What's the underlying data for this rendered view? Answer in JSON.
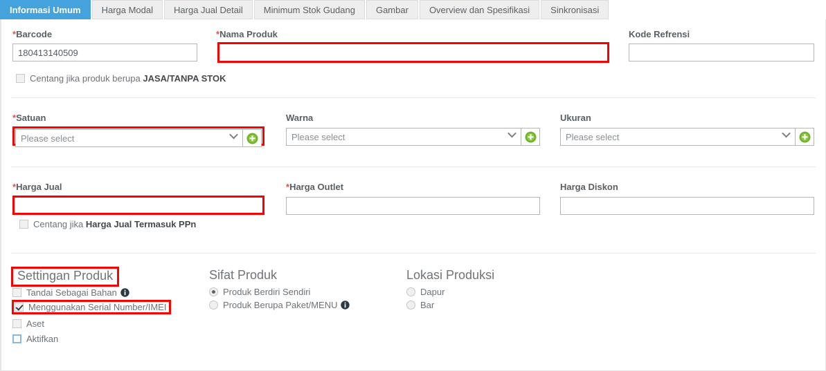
{
  "tabs": [
    {
      "label": "Informasi Umum",
      "active": true
    },
    {
      "label": "Harga Modal",
      "active": false
    },
    {
      "label": "Harga Jual Detail",
      "active": false
    },
    {
      "label": "Minimum Stok Gudang",
      "active": false
    },
    {
      "label": "Gambar",
      "active": false
    },
    {
      "label": "Overview dan Spesifikasi",
      "active": false
    },
    {
      "label": "Sinkronisasi",
      "active": false
    }
  ],
  "colors": {
    "tab_active_bg": "#44a3dd",
    "error_border": "#fb0000",
    "plus_green": "#6eb42b",
    "required_star": "#d9534f",
    "label_text": "#595f63"
  },
  "section_identity": {
    "barcode": {
      "star": "*",
      "label": "Barcode",
      "value": "180413140509",
      "placeholder": ""
    },
    "nama_produk": {
      "star": "*",
      "label": "Nama Produk",
      "value": "",
      "placeholder": ""
    },
    "kode_refrensi": {
      "star": "",
      "label": "Kode Refrensi",
      "value": "",
      "placeholder": ""
    },
    "jasa_checkbox": {
      "prefix": "Centang jika produk berupa ",
      "strong": "JASA/TANPA STOK",
      "checked": false
    }
  },
  "section_variant": {
    "satuan": {
      "star": "*",
      "label": "Satuan",
      "selected": "Please select",
      "add_button": "plus",
      "error": true
    },
    "warna": {
      "star": "",
      "label": "Warna",
      "selected": "Please select",
      "add_button": "plus",
      "error": false
    },
    "ukuran": {
      "star": "",
      "label": "Ukuran",
      "selected": "Please select",
      "add_button": "plus",
      "error": false
    }
  },
  "section_price": {
    "harga_jual": {
      "star": "*",
      "label": "Harga Jual",
      "value": "",
      "error": true
    },
    "harga_outlet": {
      "star": "*",
      "label": "Harga Outlet",
      "value": "",
      "error": false
    },
    "harga_diskon": {
      "star": "",
      "label": "Harga Diskon",
      "value": "",
      "error": false
    },
    "ppn_checkbox": {
      "prefix": "Centang jika ",
      "strong": "Harga Jual Termasuk PPn",
      "checked": false
    }
  },
  "section_settings": {
    "heading": "Settingan Produk",
    "items": [
      {
        "label": "Tandai Sebagai Bahan",
        "checked": false,
        "info": true,
        "error": false,
        "style": "plain"
      },
      {
        "label": "Menggunakan Serial Number/IMEI",
        "checked": true,
        "info": false,
        "error": true,
        "style": "plain"
      },
      {
        "label": "Aset",
        "checked": false,
        "info": false,
        "error": false,
        "style": "plain"
      },
      {
        "label": "Aktifkan",
        "checked": false,
        "info": false,
        "error": false,
        "style": "blue"
      }
    ]
  },
  "section_sifat": {
    "heading": "Sifat Produk",
    "options": [
      {
        "label": "Produk Berdiri Sendiri",
        "selected": true,
        "info": false
      },
      {
        "label": "Produk Berupa Paket/MENU",
        "selected": false,
        "info": true
      }
    ]
  },
  "section_lokasi": {
    "heading": "Lokasi Produksi",
    "options": [
      {
        "label": "Dapur",
        "selected": false,
        "info": false
      },
      {
        "label": "Bar",
        "selected": false,
        "info": false
      }
    ]
  }
}
